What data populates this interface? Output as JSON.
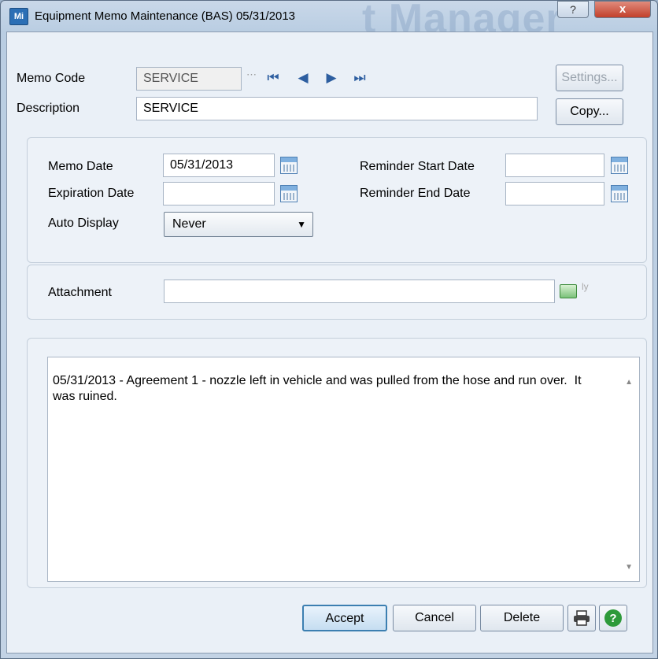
{
  "window": {
    "title": "Equipment Memo Maintenance (BAS) 05/31/2013",
    "app_icon": "Mi",
    "watermark": "t Manager",
    "help_button": "?",
    "close_button": "x"
  },
  "header": {
    "memo_code_label": "Memo Code",
    "memo_code_value": "SERVICE",
    "description_label": "Description",
    "description_value": "SERVICE",
    "settings_button": "Settings...",
    "copy_button": "Copy...",
    "nav_first": "⏮",
    "nav_prev": "◀",
    "nav_next": "▶",
    "nav_last": "⏭"
  },
  "dates": {
    "memo_date_label": "Memo Date",
    "memo_date_value": "05/31/2013",
    "expiration_date_label": "Expiration Date",
    "expiration_date_value": "",
    "auto_display_label": "Auto Display",
    "auto_display_value": "Never",
    "reminder_start_label": "Reminder Start Date",
    "reminder_start_value": "",
    "reminder_end_label": "Reminder End Date",
    "reminder_end_value": ""
  },
  "attachment": {
    "label": "Attachment",
    "value": ""
  },
  "memo": {
    "text": "05/31/2013 - Agreement 1 - nozzle left in vehicle and was pulled from the hose and run over.  It was ruined."
  },
  "footer": {
    "accept_button": "Accept",
    "cancel_button": "Cancel",
    "delete_button": "Delete"
  },
  "colors": {
    "window_bg": "#eaf0f7",
    "title_bar": "#c9d8e9",
    "close_red": "#c2402b",
    "nav_blue": "#2d5ea0",
    "help_green": "#2e9a3a"
  }
}
